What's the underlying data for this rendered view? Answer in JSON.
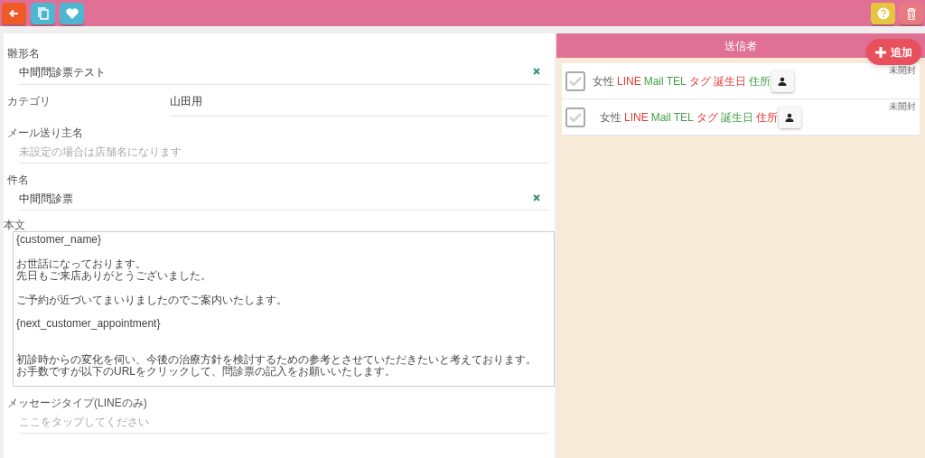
{
  "toolbar": {
    "left": [
      {
        "kind": "back"
      },
      {
        "kind": "copy"
      },
      {
        "kind": "favorite"
      }
    ],
    "right": [
      {
        "kind": "help"
      },
      {
        "kind": "delete"
      }
    ]
  },
  "form": {
    "fields": [
      {
        "kind": "text",
        "label": "雛形名",
        "value": "中間問診票テスト",
        "clearable": true
      },
      {
        "kind": "inline",
        "label": "カテゴリ",
        "value": "山田用"
      },
      {
        "kind": "text",
        "label": "メール送り主名",
        "placeholder": "未設定の場合は店舗名になります"
      },
      {
        "kind": "text",
        "label": "件名",
        "value": "中間問診票",
        "clearable": true
      },
      {
        "kind": "textarea",
        "label": "本文",
        "paragraphs": [
          {
            "wide_gap": false,
            "lines": [
              "{customer_name}"
            ]
          },
          {
            "wide_gap": false,
            "lines": [
              "お世話になっております。",
              "先日もご来店ありがとうございました。"
            ]
          },
          {
            "wide_gap": false,
            "lines": [
              "ご予約が近づいてまいりましたのでご案内いたします。"
            ]
          },
          {
            "wide_gap": false,
            "lines": [
              "{next_customer_appointment}"
            ]
          },
          {
            "wide_gap": true,
            "lines": [
              "初診時からの変化を伺い、今後の治療方針を検討するための参考とさせていただきたいと考えております。",
              "お手数ですが以下のURLをクリックして、問診票の記入をお願いいたします。"
            ]
          }
        ]
      },
      {
        "kind": "text",
        "label": "メッセージタイプ(LINEのみ)",
        "placeholder": "ここをタップしてください"
      }
    ]
  },
  "recipients": {
    "title": "送信者",
    "add_button": "追加",
    "rows": [
      {
        "checked": false,
        "status": "未開封",
        "gender": "女性",
        "tags": [
          {
            "text": "LINE",
            "available": false
          },
          {
            "text": "Mail",
            "available": true
          },
          {
            "text": "TEL",
            "available": true
          },
          {
            "text": "タグ",
            "available": false
          },
          {
            "text": "誕生日",
            "available": false
          },
          {
            "text": "住所",
            "available": true
          }
        ]
      },
      {
        "checked": false,
        "status": "未開封",
        "gender": "女性",
        "tags": [
          {
            "text": "LINE",
            "available": false
          },
          {
            "text": "Mail",
            "available": true
          },
          {
            "text": "TEL",
            "available": true
          },
          {
            "text": "タグ",
            "available": false
          },
          {
            "text": "誕生日",
            "available": true
          },
          {
            "text": "住所",
            "available": false
          }
        ]
      }
    ]
  }
}
